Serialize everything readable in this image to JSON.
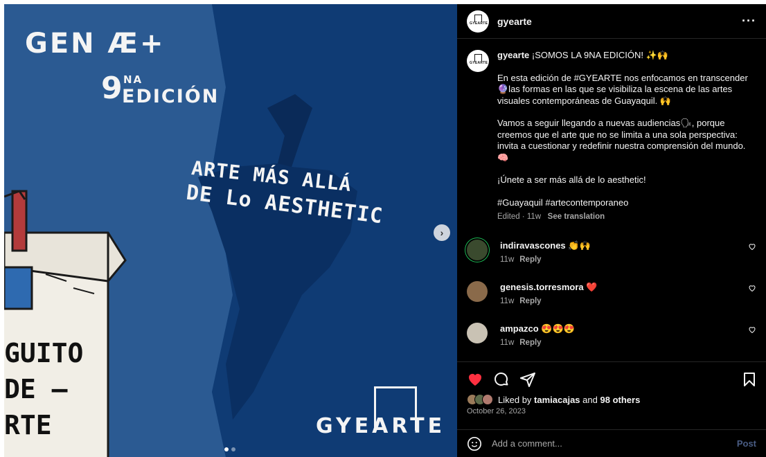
{
  "media": {
    "poster_gen": "GEN Æ+",
    "poster_edition_num": "9",
    "poster_edition_sup": "NA",
    "poster_edition_word": "EDICIÓN",
    "poster_tagline_1": "ARTE MÁS ALLÁ",
    "poster_tagline_2": "DE Lo AESTHETIC",
    "poster_guito_1": "GUITO",
    "poster_guito_2": "DE —",
    "poster_guito_3": "RTE",
    "poster_logo": "GYEARTE",
    "next_icon": "chevron-right-icon",
    "next_glyph": "›",
    "slide_count": 2,
    "active_slide": 1
  },
  "post": {
    "username": "gyearte",
    "avatar_text": "GYEARTE",
    "more_glyph": "···",
    "caption": {
      "username": "gyearte",
      "headline": " ¡SOMOS LA 9NA EDICIÓN! ✨🙌",
      "paragraph_1": "En esta edición de #GYEARTE nos enfocamos en transcender 🔮las formas en las que se visibiliza la escena de las artes visuales contemporáneas de Guayaquil. 🙌",
      "paragraph_2": "Vamos a seguir llegando a nuevas audiencias🗣, porque creemos que el arte que no se limita a una sola perspectiva: invita a cuestionar y redefinir nuestra comprensión del mundo. 🧠",
      "paragraph_3": "¡Únete a ser más allá de lo aesthetic!",
      "hashtags": "#Guayaquil #artecontemporaneo",
      "meta_time": "Edited · 11w",
      "see_translation": "See translation"
    },
    "comments": [
      {
        "user": "indiravascones",
        "text": " 👏🙌",
        "time": "11w",
        "reply": "Reply",
        "avatar_color": "#3a4a2e",
        "ring": "#1db954"
      },
      {
        "user": "genesis.torresmora",
        "text": " ❤️",
        "time": "11w",
        "reply": "Reply",
        "avatar_color": "#8a6a4a",
        "ring": ""
      },
      {
        "user": "ampazco",
        "text": " 😍😍😍",
        "time": "11w",
        "reply": "Reply",
        "avatar_color": "#c9c2b4",
        "ring": ""
      }
    ],
    "liked_prefix": "Liked by ",
    "liked_user": "tamiacajas",
    "liked_and": " and ",
    "liked_others": "98 others",
    "date": "October 26, 2023",
    "comment_placeholder": "Add a comment...",
    "post_label": "Post",
    "colors": {
      "heart": "#ff3040",
      "post_disabled": "#4a5d85",
      "secondary_text": "#a8a8a8"
    }
  }
}
